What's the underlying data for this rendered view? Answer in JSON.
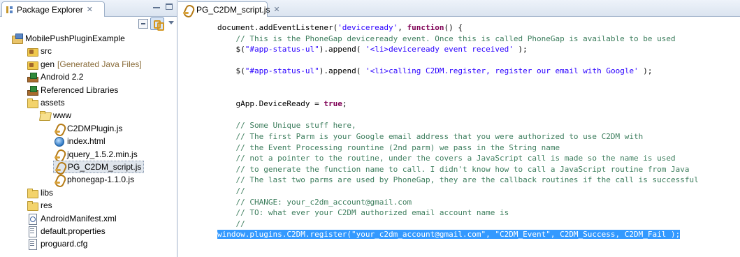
{
  "explorer": {
    "tab_title": "Package Explorer",
    "close_glyph": "✕",
    "tree": [
      {
        "label": "MobilePushPluginExample",
        "icon": "project-icon",
        "decorator": ""
      },
      {
        "label": "src",
        "icon": "srcfolder-icon",
        "decorator": ""
      },
      {
        "label": "gen",
        "icon": "srcfolder-icon",
        "decorator": "[Generated Java Files]"
      },
      {
        "label": "Android 2.2",
        "icon": "library-icon",
        "decorator": ""
      },
      {
        "label": "Referenced Libraries",
        "icon": "library-icon",
        "decorator": ""
      },
      {
        "label": "assets",
        "icon": "folder-icon",
        "decorator": ""
      },
      {
        "label": "www",
        "icon": "folder-open-icon",
        "decorator": ""
      },
      {
        "label": "C2DMPlugin.js",
        "icon": "jsfile-icon",
        "decorator": ""
      },
      {
        "label": "index.html",
        "icon": "htmlfile-icon",
        "decorator": ""
      },
      {
        "label": "jquery_1.5.2.min.js",
        "icon": "jsfile-icon",
        "decorator": ""
      },
      {
        "label": "PG_C2DM_script.js",
        "icon": "jsfile-icon",
        "decorator": ""
      },
      {
        "label": "phonegap-1.1.0.js",
        "icon": "jsfile-icon",
        "decorator": ""
      },
      {
        "label": "libs",
        "icon": "folder-icon",
        "decorator": ""
      },
      {
        "label": "res",
        "icon": "folder-icon",
        "decorator": ""
      },
      {
        "label": "AndroidManifest.xml",
        "icon": "xmlfile-icon",
        "decorator": ""
      },
      {
        "label": "default.properties",
        "icon": "textfile-icon",
        "decorator": ""
      },
      {
        "label": "proguard.cfg",
        "icon": "textfile-icon",
        "decorator": ""
      }
    ],
    "selected_index": 10
  },
  "editor": {
    "tab_title": "PG_C2DM_script.js",
    "close_glyph": "✕",
    "lines": [
      {
        "parts": [
          {
            "t": "document.addEventListener(",
            "c": ""
          },
          {
            "t": "'deviceready'",
            "c": "str"
          },
          {
            "t": ", ",
            "c": ""
          },
          {
            "t": "function",
            "c": "kw"
          },
          {
            "t": "() {",
            "c": ""
          }
        ]
      },
      {
        "parts": [
          {
            "t": "    // This is the PhoneGap deviceready event. Once this is called PhoneGap is available to be used",
            "c": "cmt"
          }
        ]
      },
      {
        "parts": [
          {
            "t": "    $(",
            "c": ""
          },
          {
            "t": "\"#app-status-ul\"",
            "c": "str"
          },
          {
            "t": ").append( ",
            "c": ""
          },
          {
            "t": "'<li>deviceready event received'",
            "c": "str"
          },
          {
            "t": " );",
            "c": ""
          }
        ]
      },
      {
        "parts": [
          {
            "t": "",
            "c": ""
          }
        ]
      },
      {
        "parts": [
          {
            "t": "    $(",
            "c": ""
          },
          {
            "t": "\"#app-status-ul\"",
            "c": "str"
          },
          {
            "t": ").append( ",
            "c": ""
          },
          {
            "t": "'<li>calling C2DM.register, register our email with Google'",
            "c": "str"
          },
          {
            "t": " );",
            "c": ""
          }
        ]
      },
      {
        "parts": [
          {
            "t": "",
            "c": ""
          }
        ]
      },
      {
        "parts": [
          {
            "t": "",
            "c": ""
          }
        ]
      },
      {
        "parts": [
          {
            "t": "    gApp.DeviceReady = ",
            "c": ""
          },
          {
            "t": "true",
            "c": "kw"
          },
          {
            "t": ";",
            "c": ""
          }
        ]
      },
      {
        "parts": [
          {
            "t": "",
            "c": ""
          }
        ]
      },
      {
        "parts": [
          {
            "t": "    // Some Unique stuff here,",
            "c": "cmt"
          }
        ]
      },
      {
        "parts": [
          {
            "t": "    // The first Parm is your Google email address that you were authorized to use C2DM with",
            "c": "cmt"
          }
        ]
      },
      {
        "parts": [
          {
            "t": "    // the Event Processing rountine (2nd parm) we pass in the String name",
            "c": "cmt"
          }
        ]
      },
      {
        "parts": [
          {
            "t": "    // not a pointer to the routine, under the covers a JavaScript call is made so the name is used",
            "c": "cmt"
          }
        ]
      },
      {
        "parts": [
          {
            "t": "    // to generate the function name to call. I didn't know how to call a JavaScript routine from Java",
            "c": "cmt"
          }
        ]
      },
      {
        "parts": [
          {
            "t": "    // The last two parms are used by PhoneGap, they are the callback routines if the call is successful",
            "c": "cmt"
          }
        ]
      },
      {
        "parts": [
          {
            "t": "    //",
            "c": "cmt"
          }
        ]
      },
      {
        "parts": [
          {
            "t": "    // CHANGE: your_c2dm_account@gmail.com",
            "c": "cmt"
          }
        ]
      },
      {
        "parts": [
          {
            "t": "    // TO: what ever your C2DM authorized email account name is",
            "c": "cmt"
          }
        ]
      },
      {
        "parts": [
          {
            "t": "    //",
            "c": "cmt"
          }
        ]
      },
      {
        "parts": [
          {
            "t": "window.plugins.C2DM.register(\"your_c2dm_account@gmail.com\", \"C2DM_Event\", C2DM_Success, C2DM_Fail );",
            "c": "hl"
          }
        ],
        "highlight": true
      }
    ]
  }
}
